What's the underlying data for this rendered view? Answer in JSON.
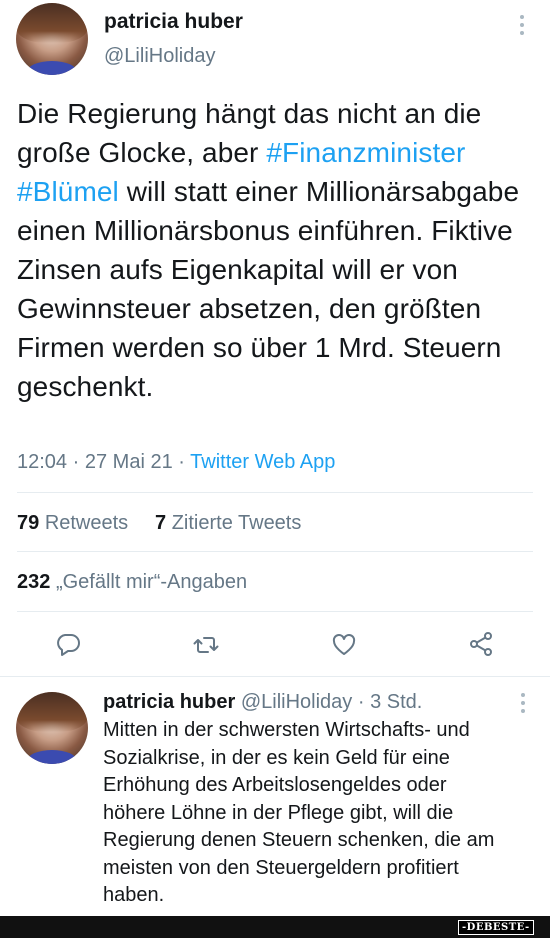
{
  "main_tweet": {
    "author_name": "patricia huber",
    "author_handle": "@LiliHoliday",
    "text_parts": [
      "Die Regierung hängt das nicht an die große Glocke, aber ",
      "#Finanzminister",
      " ",
      "#Blümel",
      " will statt einer Millionärsabgabe einen Millionärsbonus einführen. Fiktive Zinsen aufs Eigenkapital will er von Gewinnsteuer absetzen, den größten Firmen werden so über 1 Mrd. Steuern geschenkt."
    ],
    "time": "12:04",
    "date": "27 Mai 21",
    "source": "Twitter Web App",
    "retweets_count": "79",
    "retweets_label": "Retweets",
    "quotes_count": "7",
    "quotes_label": "Zitierte Tweets",
    "likes_count": "232",
    "likes_label": "„Gefällt mir“-Angaben"
  },
  "reply_tweet": {
    "author_name": "patricia huber",
    "author_handle": "@LiliHoliday",
    "separator": "·",
    "age": "3 Std.",
    "text": "Mitten in der schwersten Wirtschafts- und Sozialkrise, in der es kein Geld für eine Erhöhung des Arbeitslosengeldes oder höhere Löhne in der Pflege gibt, will die Regierung denen Steuern schenken, die am meisten von den Steuergeldern profitiert haben."
  },
  "meta_separator": "·",
  "icons": [
    "reply-icon",
    "retweet-icon",
    "like-icon",
    "share-icon",
    "more-icon"
  ],
  "colors": {
    "accent": "#1da1f2",
    "muted": "#657786",
    "text": "#14171a",
    "divider": "#e6ecf0"
  },
  "watermark": "-DEBESTE-"
}
